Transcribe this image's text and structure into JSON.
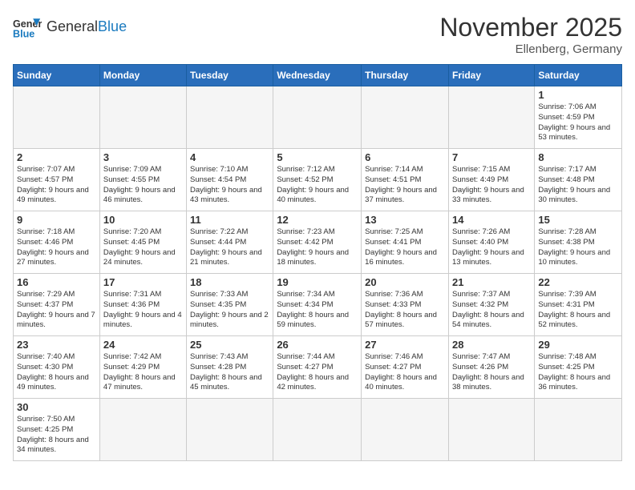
{
  "header": {
    "logo_general": "General",
    "logo_blue": "Blue",
    "month_title": "November 2025",
    "location": "Ellenberg, Germany"
  },
  "weekdays": [
    "Sunday",
    "Monday",
    "Tuesday",
    "Wednesday",
    "Thursday",
    "Friday",
    "Saturday"
  ],
  "days": {
    "1": {
      "sunrise": "7:06 AM",
      "sunset": "4:59 PM",
      "daylight": "9 hours and 53 minutes."
    },
    "2": {
      "sunrise": "7:07 AM",
      "sunset": "4:57 PM",
      "daylight": "9 hours and 49 minutes."
    },
    "3": {
      "sunrise": "7:09 AM",
      "sunset": "4:55 PM",
      "daylight": "9 hours and 46 minutes."
    },
    "4": {
      "sunrise": "7:10 AM",
      "sunset": "4:54 PM",
      "daylight": "9 hours and 43 minutes."
    },
    "5": {
      "sunrise": "7:12 AM",
      "sunset": "4:52 PM",
      "daylight": "9 hours and 40 minutes."
    },
    "6": {
      "sunrise": "7:14 AM",
      "sunset": "4:51 PM",
      "daylight": "9 hours and 37 minutes."
    },
    "7": {
      "sunrise": "7:15 AM",
      "sunset": "4:49 PM",
      "daylight": "9 hours and 33 minutes."
    },
    "8": {
      "sunrise": "7:17 AM",
      "sunset": "4:48 PM",
      "daylight": "9 hours and 30 minutes."
    },
    "9": {
      "sunrise": "7:18 AM",
      "sunset": "4:46 PM",
      "daylight": "9 hours and 27 minutes."
    },
    "10": {
      "sunrise": "7:20 AM",
      "sunset": "4:45 PM",
      "daylight": "9 hours and 24 minutes."
    },
    "11": {
      "sunrise": "7:22 AM",
      "sunset": "4:44 PM",
      "daylight": "9 hours and 21 minutes."
    },
    "12": {
      "sunrise": "7:23 AM",
      "sunset": "4:42 PM",
      "daylight": "9 hours and 18 minutes."
    },
    "13": {
      "sunrise": "7:25 AM",
      "sunset": "4:41 PM",
      "daylight": "9 hours and 16 minutes."
    },
    "14": {
      "sunrise": "7:26 AM",
      "sunset": "4:40 PM",
      "daylight": "9 hours and 13 minutes."
    },
    "15": {
      "sunrise": "7:28 AM",
      "sunset": "4:38 PM",
      "daylight": "9 hours and 10 minutes."
    },
    "16": {
      "sunrise": "7:29 AM",
      "sunset": "4:37 PM",
      "daylight": "9 hours and 7 minutes."
    },
    "17": {
      "sunrise": "7:31 AM",
      "sunset": "4:36 PM",
      "daylight": "9 hours and 4 minutes."
    },
    "18": {
      "sunrise": "7:33 AM",
      "sunset": "4:35 PM",
      "daylight": "9 hours and 2 minutes."
    },
    "19": {
      "sunrise": "7:34 AM",
      "sunset": "4:34 PM",
      "daylight": "8 hours and 59 minutes."
    },
    "20": {
      "sunrise": "7:36 AM",
      "sunset": "4:33 PM",
      "daylight": "8 hours and 57 minutes."
    },
    "21": {
      "sunrise": "7:37 AM",
      "sunset": "4:32 PM",
      "daylight": "8 hours and 54 minutes."
    },
    "22": {
      "sunrise": "7:39 AM",
      "sunset": "4:31 PM",
      "daylight": "8 hours and 52 minutes."
    },
    "23": {
      "sunrise": "7:40 AM",
      "sunset": "4:30 PM",
      "daylight": "8 hours and 49 minutes."
    },
    "24": {
      "sunrise": "7:42 AM",
      "sunset": "4:29 PM",
      "daylight": "8 hours and 47 minutes."
    },
    "25": {
      "sunrise": "7:43 AM",
      "sunset": "4:28 PM",
      "daylight": "8 hours and 45 minutes."
    },
    "26": {
      "sunrise": "7:44 AM",
      "sunset": "4:27 PM",
      "daylight": "8 hours and 42 minutes."
    },
    "27": {
      "sunrise": "7:46 AM",
      "sunset": "4:27 PM",
      "daylight": "8 hours and 40 minutes."
    },
    "28": {
      "sunrise": "7:47 AM",
      "sunset": "4:26 PM",
      "daylight": "8 hours and 38 minutes."
    },
    "29": {
      "sunrise": "7:48 AM",
      "sunset": "4:25 PM",
      "daylight": "8 hours and 36 minutes."
    },
    "30": {
      "sunrise": "7:50 AM",
      "sunset": "4:25 PM",
      "daylight": "8 hours and 34 minutes."
    }
  }
}
